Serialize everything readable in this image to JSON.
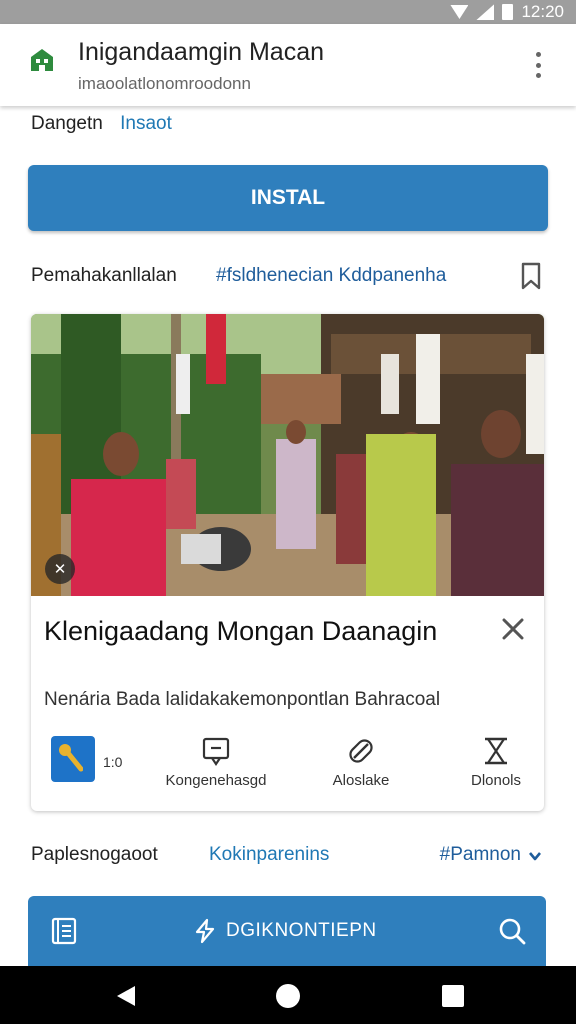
{
  "status_bar": {
    "time": "12:20"
  },
  "app_bar": {
    "title": "Inigandaamgin Macan",
    "url": "imaoolatlonomroodonn"
  },
  "crumb": {
    "first": "Dangetn",
    "second": "Insaot"
  },
  "install": {
    "label": "INSTAL"
  },
  "section": {
    "left": "Pemahakanllalan",
    "tag": "#fsldhenecian Kddpanenha"
  },
  "card": {
    "headline": "Klenigaadang Mongan Daanagin",
    "subline": "Nenária Bada lalidakakemonpontlan Bahracoal",
    "app_count": "1:0",
    "actions": [
      {
        "label": "Kongenehasgd",
        "icon": "message-icon"
      },
      {
        "label": "Aloslake",
        "icon": "link-icon"
      },
      {
        "label": "Dlonols",
        "icon": "hourglass-icon"
      }
    ]
  },
  "filter_row": {
    "left": "Paplesnogaoot",
    "middle": "Kokinparenins",
    "right": "#Pamnon"
  },
  "search_bar": {
    "label": "DGIKNONTIEPN"
  },
  "colors": {
    "accent": "#2f7fbd",
    "link": "#1f78b4",
    "status_bar": "#9e9e9e"
  }
}
